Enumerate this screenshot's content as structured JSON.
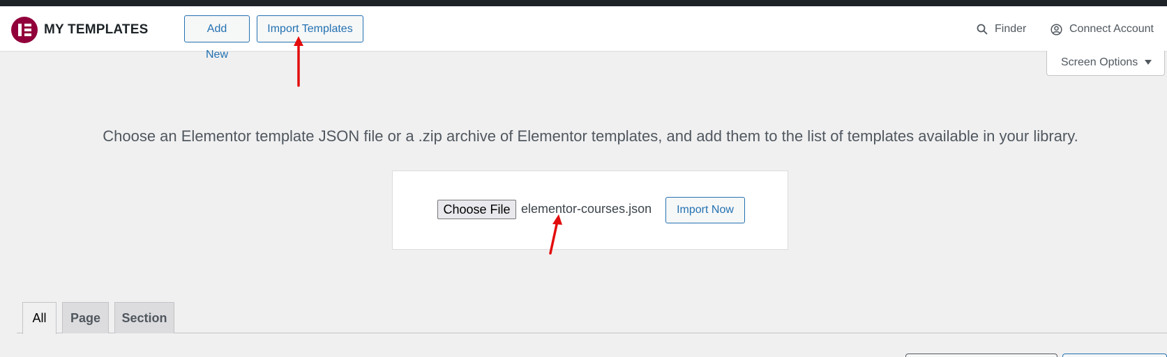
{
  "header": {
    "app_title": "MY TEMPLATES",
    "add_new_label": "Add New",
    "import_templates_label": "Import Templates",
    "finder_label": "Finder",
    "connect_account_label": "Connect Account",
    "logo_icon": "elementor-logo-icon"
  },
  "screen_options": {
    "label": "Screen Options"
  },
  "import": {
    "description": "Choose an Elementor template JSON file or a .zip archive of Elementor templates, and add them to the list of templates available in your library.",
    "choose_file_label": "Choose File",
    "file_name": "elementor-courses.json",
    "import_now_label": "Import Now"
  },
  "tabs": [
    {
      "label": "All",
      "active": true
    },
    {
      "label": "Page",
      "active": false
    },
    {
      "label": "Section",
      "active": false
    }
  ],
  "colors": {
    "accent": "#2271b1",
    "brand": "#92003b",
    "annotation": "#e30d0d"
  }
}
